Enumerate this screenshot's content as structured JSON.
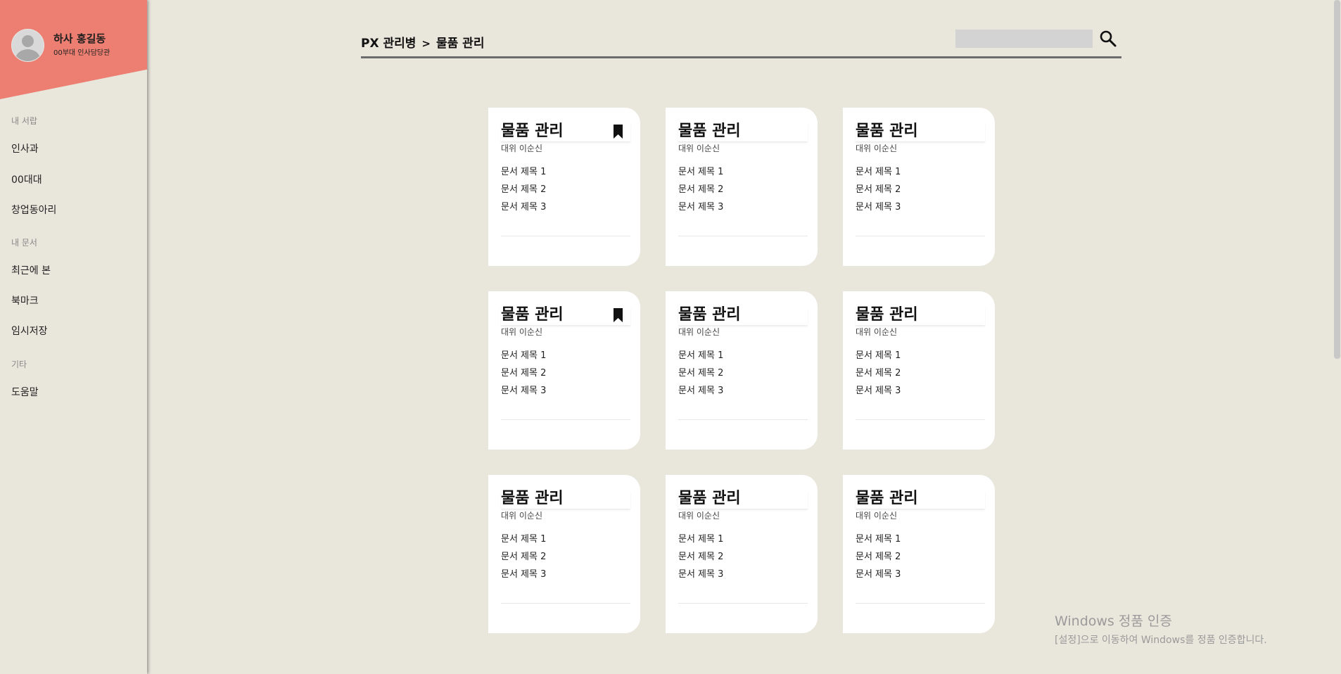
{
  "user": {
    "name": "하사 홍길동",
    "role": "00부대 인사담당관"
  },
  "sidebar": {
    "sections": [
      {
        "title": "내 서랍",
        "items": [
          "인사과",
          "00대대",
          "창업동아리"
        ]
      },
      {
        "title": "내 문서",
        "items": [
          "최근에 본",
          "북마크",
          "임시저장"
        ]
      },
      {
        "title": "기타",
        "items": [
          "도움말"
        ]
      }
    ]
  },
  "header": {
    "breadcrumb": [
      "PX 관리병",
      "물품 관리"
    ],
    "separator": ">",
    "search": {
      "value": "",
      "placeholder": ""
    }
  },
  "cards": [
    {
      "title": "물품 관리",
      "author": "대위 이순신",
      "docs": [
        "문서 제목 1",
        "문서 제목 2",
        "문서 제목 3"
      ],
      "bookmarked": true
    },
    {
      "title": "물품 관리",
      "author": "대위 이순신",
      "docs": [
        "문서 제목 1",
        "문서 제목 2",
        "문서 제목 3"
      ],
      "bookmarked": false
    },
    {
      "title": "물품 관리",
      "author": "대위 이순신",
      "docs": [
        "문서 제목 1",
        "문서 제목 2",
        "문서 제목 3"
      ],
      "bookmarked": false
    },
    {
      "title": "물품 관리",
      "author": "대위 이순신",
      "docs": [
        "문서 제목 1",
        "문서 제목 2",
        "문서 제목 3"
      ],
      "bookmarked": true
    },
    {
      "title": "물품 관리",
      "author": "대위 이순신",
      "docs": [
        "문서 제목 1",
        "문서 제목 2",
        "문서 제목 3"
      ],
      "bookmarked": false
    },
    {
      "title": "물품 관리",
      "author": "대위 이순신",
      "docs": [
        "문서 제목 1",
        "문서 제목 2",
        "문서 제목 3"
      ],
      "bookmarked": false
    },
    {
      "title": "물품 관리",
      "author": "대위 이순신",
      "docs": [
        "문서 제목 1",
        "문서 제목 2",
        "문서 제목 3"
      ],
      "bookmarked": false
    },
    {
      "title": "물품 관리",
      "author": "대위 이순신",
      "docs": [
        "문서 제목 1",
        "문서 제목 2",
        "문서 제목 3"
      ],
      "bookmarked": false
    },
    {
      "title": "물품 관리",
      "author": "대위 이순신",
      "docs": [
        "문서 제목 1",
        "문서 제목 2",
        "문서 제목 3"
      ],
      "bookmarked": false
    }
  ],
  "watermark": {
    "line1": "Windows 정품 인증",
    "line2": "[설정]으로 이동하여 Windows를 정품 인증합니다."
  },
  "colors": {
    "accent": "#ec7f71",
    "background": "#e9e6dc",
    "card": "#ffffff"
  },
  "icons": {
    "search": "search-icon",
    "bookmark": "bookmark-icon",
    "avatar": "avatar-icon"
  }
}
